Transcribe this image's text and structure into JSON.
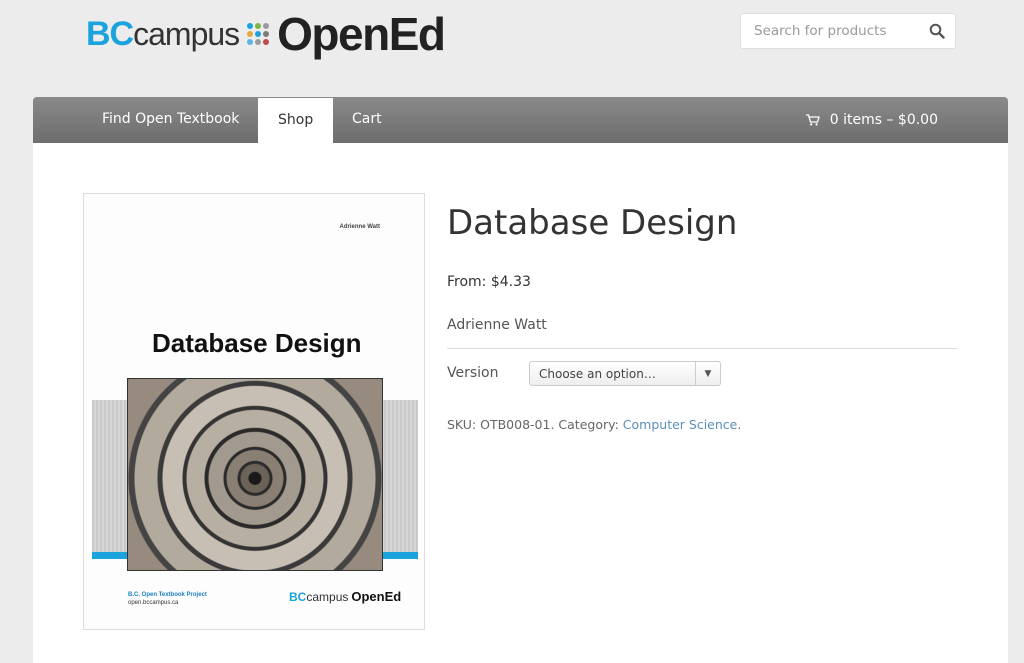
{
  "header": {
    "logo": {
      "bc": "BC",
      "campus": "campus",
      "opened": "OpenEd"
    },
    "search": {
      "placeholder": "Search for products"
    }
  },
  "nav": {
    "items": [
      {
        "label": "Find Open Textbook",
        "active": false
      },
      {
        "label": "Shop",
        "active": true
      },
      {
        "label": "Cart",
        "active": false
      }
    ],
    "cart_summary": "0 items – $0.00"
  },
  "product": {
    "cover": {
      "author": "Adrienne Watt",
      "title": "Database Design",
      "footer_line1": "B.C. Open Textbook Project",
      "footer_line2": "open.bccampus.ca",
      "logo_bc": "BC",
      "logo_campus": "campus",
      "logo_opened": "OpenEd"
    },
    "title": "Database Design",
    "price": "From: $4.33",
    "author": "Adrienne Watt",
    "version_label": "Version",
    "version_select": {
      "selected": "Choose an option…"
    },
    "sku_text": "SKU: OTB008-01. Category: ",
    "category": "Computer Science",
    "category_suffix": "."
  },
  "colors": {
    "brand_blue": "#1aa3dc",
    "nav_bg": "#7a7a7a",
    "link": "#5a8fb8",
    "logo_dots": [
      "#1aa3dc",
      "#7ab648",
      "#9b9b9b",
      "#e2a93b",
      "#1aa3dc",
      "#7a7a7a",
      "#5bb6e0",
      "#9b9b9b",
      "#c04848"
    ]
  }
}
